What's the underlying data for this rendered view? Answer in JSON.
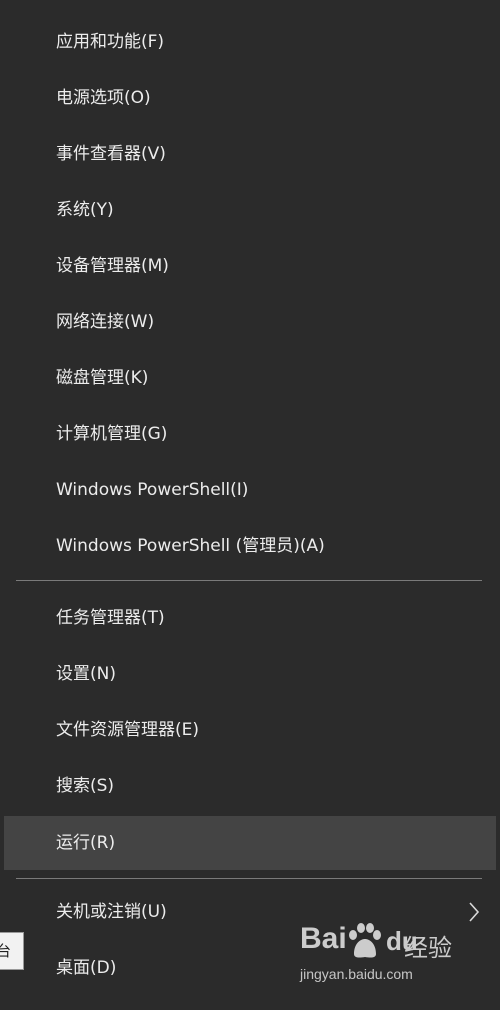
{
  "menu": {
    "items": [
      {
        "label": "应用和功能(F)"
      },
      {
        "label": "电源选项(O)"
      },
      {
        "label": "事件查看器(V)"
      },
      {
        "label": "系统(Y)"
      },
      {
        "label": "设备管理器(M)"
      },
      {
        "label": "网络连接(W)"
      },
      {
        "label": "磁盘管理(K)"
      },
      {
        "label": "计算机管理(G)"
      },
      {
        "label": "Windows PowerShell(I)"
      },
      {
        "label": "Windows PowerShell (管理员)(A)"
      },
      {
        "label": "任务管理器(T)"
      },
      {
        "label": "设置(N)"
      },
      {
        "label": "文件资源管理器(E)"
      },
      {
        "label": "搜索(S)"
      },
      {
        "label": "运行(R)",
        "highlighted": true
      },
      {
        "label": "关机或注销(U)",
        "has_submenu": true
      },
      {
        "label": "桌面(D)"
      }
    ],
    "submenu_icon": "chevron-right-icon"
  },
  "tooltip": {
    "text": "台"
  },
  "watermark": {
    "logo_bai": "Bai",
    "logo_du": "du",
    "logo_cn": "经验",
    "url": "jingyan.baidu.com",
    "icon": "paw-icon"
  },
  "colors": {
    "background": "#2b2b2b",
    "hover": "#444444",
    "separator": "#7a7a7a",
    "text": "#ececec"
  }
}
